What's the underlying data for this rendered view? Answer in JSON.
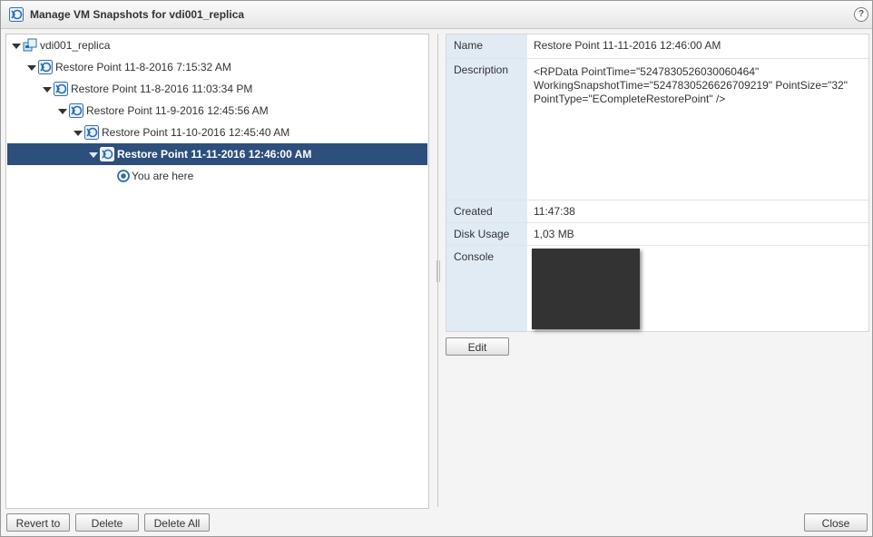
{
  "window": {
    "title": "Manage VM Snapshots for vdi001_replica",
    "help_label": "?"
  },
  "tree": {
    "root": "vdi001_replica",
    "items": [
      "Restore Point 11-8-2016 7:15:32 AM",
      "Restore Point 11-8-2016 11:03:34 PM",
      "Restore Point 11-9-2016 12:45:56 AM",
      "Restore Point 11-10-2016 12:45:40 AM",
      "Restore Point 11-11-2016 12:46:00 AM"
    ],
    "current": "You are here"
  },
  "properties": {
    "name_label": "Name",
    "name_value": "Restore Point 11-11-2016 12:46:00 AM",
    "description_label": "Description",
    "description_value": "<RPData PointTime=\"5247830526030060464\" WorkingSnapshotTime=\"5247830526626709219\" PointSize=\"32\" PointType=\"ECompleteRestorePoint\" />",
    "created_label": "Created",
    "created_value": "11:47:38",
    "disk_usage_label": "Disk Usage",
    "disk_usage_value": "1,03 MB",
    "console_label": "Console"
  },
  "buttons": {
    "edit": "Edit",
    "revert": "Revert to",
    "delete": "Delete",
    "delete_all": "Delete All",
    "close": "Close"
  },
  "colors": {
    "selection": "#2c4f7c",
    "key_column": "#e1ebf4",
    "snapshot_icon": "#2b6cb0"
  }
}
